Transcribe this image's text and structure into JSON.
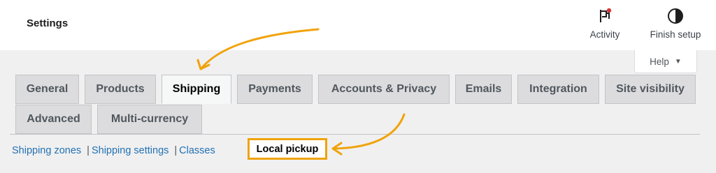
{
  "header": {
    "title": "Settings",
    "activity_label": "Activity",
    "finish_setup_label": "Finish setup",
    "notification_color": "#d63638"
  },
  "help": {
    "label": "Help",
    "caret": "▼"
  },
  "tabs": [
    {
      "label": "General",
      "active": false
    },
    {
      "label": "Products",
      "active": false
    },
    {
      "label": "Shipping",
      "active": true
    },
    {
      "label": "Payments",
      "active": false
    },
    {
      "label": "Accounts & Privacy",
      "active": false
    },
    {
      "label": "Emails",
      "active": false
    },
    {
      "label": "Integration",
      "active": false
    },
    {
      "label": "Site visibility",
      "active": false
    },
    {
      "label": "Advanced",
      "active": false
    },
    {
      "label": "Multi-currency",
      "active": false
    }
  ],
  "subnav": {
    "separator": "|",
    "items": [
      {
        "label": "Shipping zones"
      },
      {
        "label": "Shipping settings"
      },
      {
        "label": "Classes"
      }
    ],
    "current": "Local pickup"
  },
  "annotation_color": "#f0a30a"
}
